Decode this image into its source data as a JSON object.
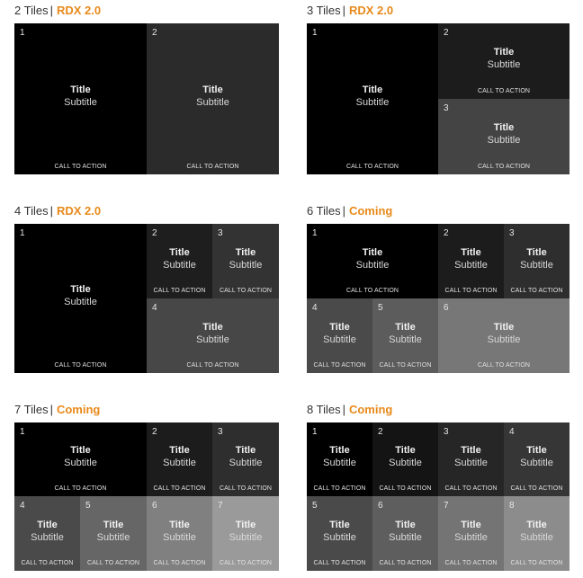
{
  "panels": [
    {
      "count": "2 Tiles",
      "sep": "|",
      "status": "RDX 2.0",
      "tiles": [
        {
          "num": "1",
          "title": "Title",
          "subtitle": "Subtitle",
          "cta": "CALL TO ACTION",
          "color": "#000000"
        },
        {
          "num": "2",
          "title": "Title",
          "subtitle": "Subtitle",
          "cta": "CALL TO ACTION",
          "color": "#2b2b2b"
        }
      ]
    },
    {
      "count": "3 Tiles",
      "sep": "|",
      "status": "RDX 2.0",
      "tiles": [
        {
          "num": "1",
          "title": "Title",
          "subtitle": "Subtitle",
          "cta": "CALL TO ACTION",
          "color": "#000000"
        },
        {
          "num": "2",
          "title": "Title",
          "subtitle": "Subtitle",
          "cta": "CALL TO ACTION",
          "color": "#1c1c1c"
        },
        {
          "num": "3",
          "title": "Title",
          "subtitle": "Subtitle",
          "cta": "CALL TO ACTION",
          "color": "#444444"
        }
      ]
    },
    {
      "count": "4 Tiles",
      "sep": "|",
      "status": "RDX 2.0",
      "tiles": [
        {
          "num": "1",
          "title": "Title",
          "subtitle": "Subtitle",
          "cta": "CALL TO ACTION",
          "color": "#000000"
        },
        {
          "num": "2",
          "title": "Title",
          "subtitle": "Subtitle",
          "cta": "CALL TO ACTION",
          "color": "#1e1e1e"
        },
        {
          "num": "3",
          "title": "Title",
          "subtitle": "Subtitle",
          "cta": "CALL TO ACTION",
          "color": "#333333"
        },
        {
          "num": "4",
          "title": "Title",
          "subtitle": "Subtitle",
          "cta": "CALL TO ACTION",
          "color": "#474747"
        }
      ]
    },
    {
      "count": "6 Tiles",
      "sep": "|",
      "status": "Coming",
      "tiles": [
        {
          "num": "1",
          "title": "Title",
          "subtitle": "Subtitle",
          "cta": "CALL TO ACTION",
          "color": "#000000"
        },
        {
          "num": "2",
          "title": "Title",
          "subtitle": "Subtitle",
          "cta": "CALL TO ACTION",
          "color": "#1c1c1c"
        },
        {
          "num": "3",
          "title": "Title",
          "subtitle": "Subtitle",
          "cta": "CALL TO ACTION",
          "color": "#2e2e2e"
        },
        {
          "num": "4",
          "title": "Title",
          "subtitle": "Subtitle",
          "cta": "CALL TO ACTION",
          "color": "#4a4a4a"
        },
        {
          "num": "5",
          "title": "Title",
          "subtitle": "Subtitle",
          "cta": "CALL TO ACTION",
          "color": "#5c5c5c"
        },
        {
          "num": "6",
          "title": "Title",
          "subtitle": "Subtitle",
          "cta": "CALL TO ACTION",
          "color": "#777777"
        }
      ]
    },
    {
      "count": "7 Tiles",
      "sep": "|",
      "status": "Coming",
      "tiles": [
        {
          "num": "1",
          "title": "Title",
          "subtitle": "Subtitle",
          "cta": "CALL TO ACTION",
          "color": "#000000"
        },
        {
          "num": "2",
          "title": "Title",
          "subtitle": "Subtitle",
          "cta": "CALL TO ACTION",
          "color": "#1c1c1c"
        },
        {
          "num": "3",
          "title": "Title",
          "subtitle": "Subtitle",
          "cta": "CALL TO ACTION",
          "color": "#2e2e2e"
        },
        {
          "num": "4",
          "title": "Title",
          "subtitle": "Subtitle",
          "cta": "CALL TO ACTION",
          "color": "#4a4a4a"
        },
        {
          "num": "5",
          "title": "Title",
          "subtitle": "Subtitle",
          "cta": "CALL TO ACTION",
          "color": "#666666"
        },
        {
          "num": "6",
          "title": "Title",
          "subtitle": "Subtitle",
          "cta": "CALL TO ACTION",
          "color": "#808080"
        },
        {
          "num": "7",
          "title": "Title",
          "subtitle": "Subtitle",
          "cta": "CALL TO ACTION",
          "color": "#9a9a9a"
        }
      ]
    },
    {
      "count": "8 Tiles",
      "sep": "|",
      "status": "Coming",
      "tiles": [
        {
          "num": "1",
          "title": "Title",
          "subtitle": "Subtitle",
          "cta": "CALL TO ACTION",
          "color": "#000000"
        },
        {
          "num": "2",
          "title": "Title",
          "subtitle": "Subtitle",
          "cta": "CALL TO ACTION",
          "color": "#141414"
        },
        {
          "num": "3",
          "title": "Title",
          "subtitle": "Subtitle",
          "cta": "CALL TO ACTION",
          "color": "#262626"
        },
        {
          "num": "4",
          "title": "Title",
          "subtitle": "Subtitle",
          "cta": "CALL TO ACTION",
          "color": "#363636"
        },
        {
          "num": "5",
          "title": "Title",
          "subtitle": "Subtitle",
          "cta": "CALL TO ACTION",
          "color": "#4a4a4a"
        },
        {
          "num": "6",
          "title": "Title",
          "subtitle": "Subtitle",
          "cta": "CALL TO ACTION",
          "color": "#5e5e5e"
        },
        {
          "num": "7",
          "title": "Title",
          "subtitle": "Subtitle",
          "cta": "CALL TO ACTION",
          "color": "#747474"
        },
        {
          "num": "8",
          "title": "Title",
          "subtitle": "Subtitle",
          "cta": "CALL TO ACTION",
          "color": "#8c8c8c"
        }
      ]
    }
  ]
}
